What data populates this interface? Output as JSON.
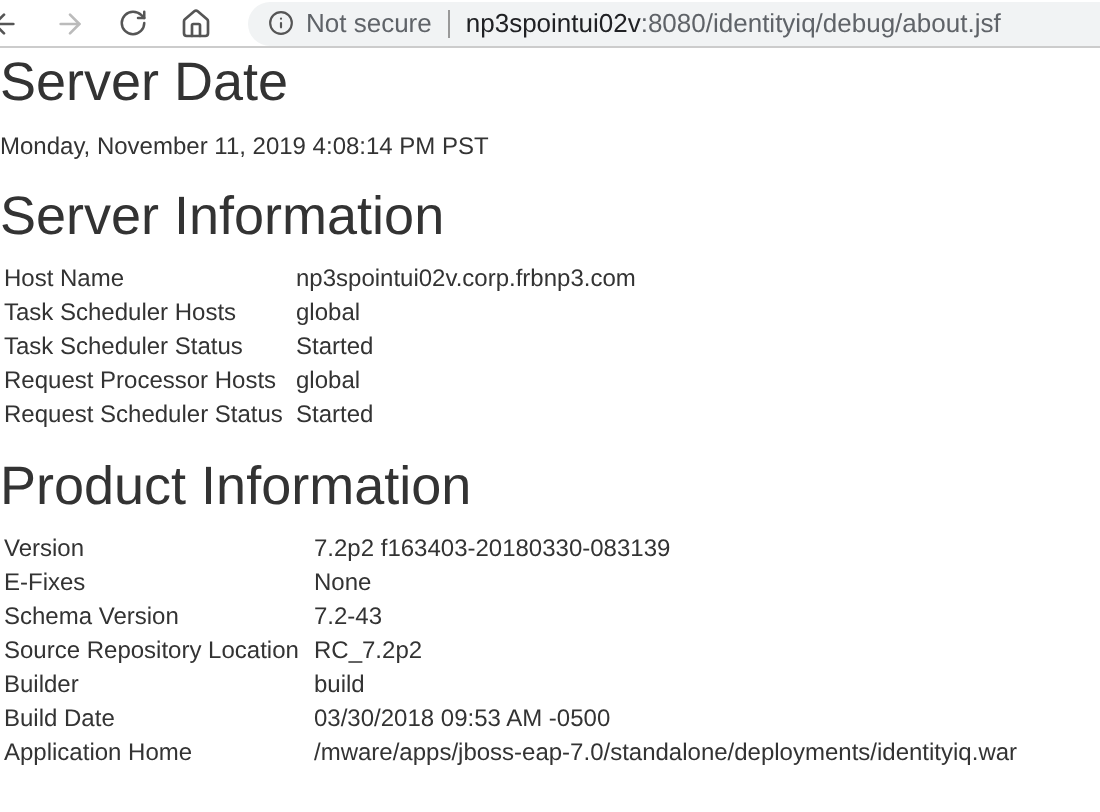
{
  "browser": {
    "security_label": "Not secure",
    "url_host": "np3spointui02v",
    "url_path": ":8080/identityiq/debug/about.jsf"
  },
  "sections": [
    {
      "title": "Server Date",
      "text": "Monday, November 11, 2019 4:08:14 PM PST"
    },
    {
      "title": "Server Information",
      "rows": [
        {
          "label": "Host Name",
          "value": "np3spointui02v.corp.frbnp3.com"
        },
        {
          "label": "Task Scheduler Hosts",
          "value": "global"
        },
        {
          "label": "Task Scheduler Status",
          "value": "Started"
        },
        {
          "label": "Request Processor Hosts",
          "value": "global"
        },
        {
          "label": "Request Scheduler Status",
          "value": "Started"
        }
      ]
    },
    {
      "title": "Product Information",
      "rows": [
        {
          "label": "Version",
          "value": "7.2p2 f163403-20180330-083139"
        },
        {
          "label": "E-Fixes",
          "value": "None"
        },
        {
          "label": "Schema Version",
          "value": "7.2-43"
        },
        {
          "label": "Source Repository Location",
          "value": "RC_7.2p2"
        },
        {
          "label": "Builder",
          "value": "build"
        },
        {
          "label": "Build Date",
          "value": "03/30/2018 09:53 AM -0500"
        },
        {
          "label": "Application Home",
          "value": "/mware/apps/jboss-eap-7.0/standalone/deployments/identityiq.war"
        }
      ]
    }
  ]
}
